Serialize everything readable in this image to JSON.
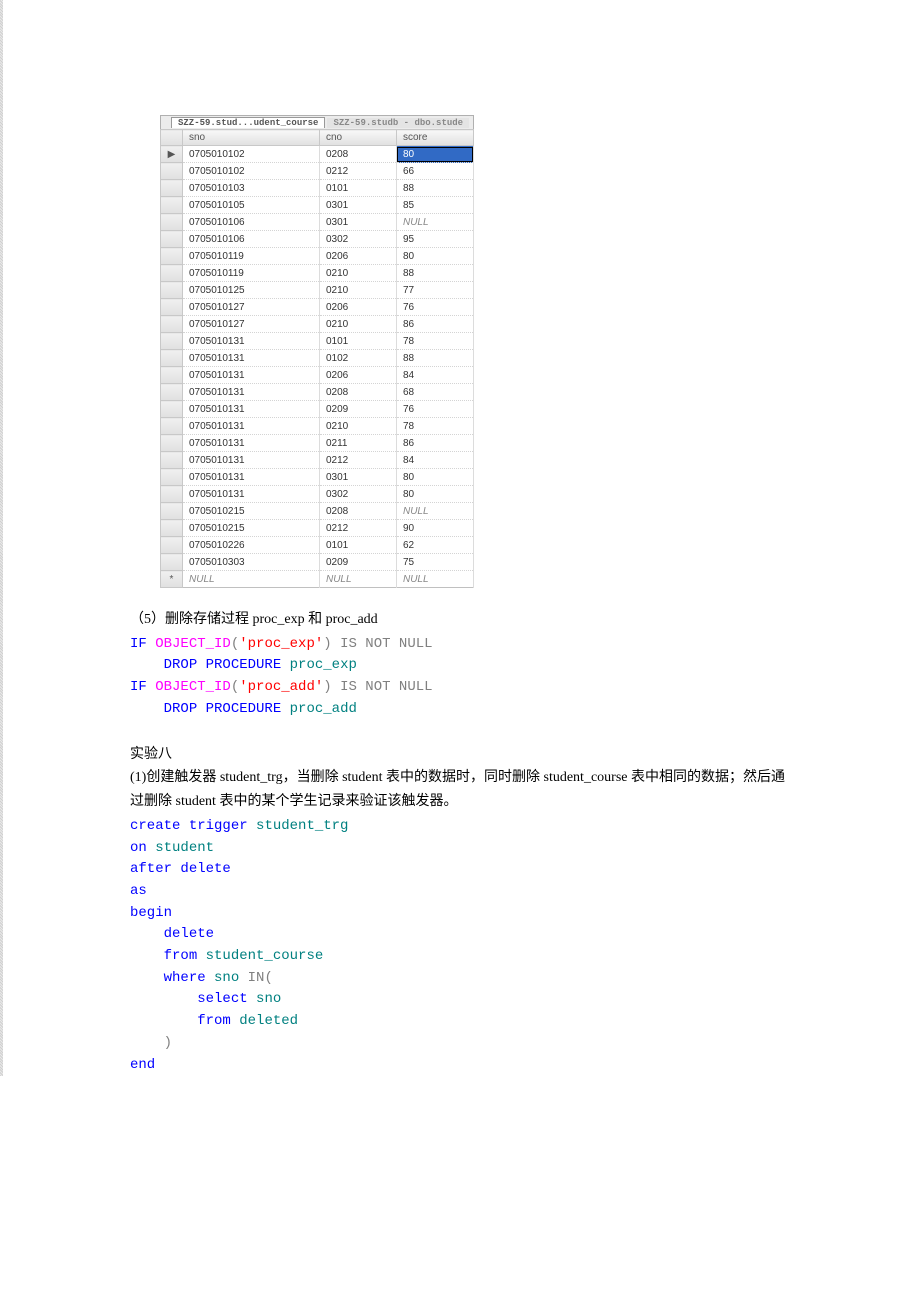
{
  "tabs": {
    "active": "SZZ-59.stud...udent_course",
    "inactive": "SZZ-59.studb - dbo.stude"
  },
  "grid": {
    "columns": [
      "sno",
      "cno",
      "score"
    ],
    "rows": [
      {
        "sno": "0705010102",
        "cno": "0208",
        "score": "80",
        "selected": true,
        "marker": "▶"
      },
      {
        "sno": "0705010102",
        "cno": "0212",
        "score": "66"
      },
      {
        "sno": "0705010103",
        "cno": "0101",
        "score": "88"
      },
      {
        "sno": "0705010105",
        "cno": "0301",
        "score": "85"
      },
      {
        "sno": "0705010106",
        "cno": "0301",
        "score": "NULL",
        "null_score": true
      },
      {
        "sno": "0705010106",
        "cno": "0302",
        "score": "95"
      },
      {
        "sno": "0705010119",
        "cno": "0206",
        "score": "80"
      },
      {
        "sno": "0705010119",
        "cno": "0210",
        "score": "88"
      },
      {
        "sno": "0705010125",
        "cno": "0210",
        "score": "77"
      },
      {
        "sno": "0705010127",
        "cno": "0206",
        "score": "76"
      },
      {
        "sno": "0705010127",
        "cno": "0210",
        "score": "86"
      },
      {
        "sno": "0705010131",
        "cno": "0101",
        "score": "78"
      },
      {
        "sno": "0705010131",
        "cno": "0102",
        "score": "88"
      },
      {
        "sno": "0705010131",
        "cno": "0206",
        "score": "84"
      },
      {
        "sno": "0705010131",
        "cno": "0208",
        "score": "68"
      },
      {
        "sno": "0705010131",
        "cno": "0209",
        "score": "76"
      },
      {
        "sno": "0705010131",
        "cno": "0210",
        "score": "78"
      },
      {
        "sno": "0705010131",
        "cno": "0211",
        "score": "86"
      },
      {
        "sno": "0705010131",
        "cno": "0212",
        "score": "84"
      },
      {
        "sno": "0705010131",
        "cno": "0301",
        "score": "80"
      },
      {
        "sno": "0705010131",
        "cno": "0302",
        "score": "80"
      },
      {
        "sno": "0705010215",
        "cno": "0208",
        "score": "NULL",
        "null_score": true
      },
      {
        "sno": "0705010215",
        "cno": "0212",
        "score": "90"
      },
      {
        "sno": "0705010226",
        "cno": "0101",
        "score": "62"
      },
      {
        "sno": "0705010303",
        "cno": "0209",
        "score": "75"
      }
    ],
    "new_row_marker": "*",
    "null_label": "NULL"
  },
  "section5": {
    "heading": "（5）删除存储过程 proc_exp 和 proc_add",
    "sql_lines": [
      [
        {
          "t": "IF",
          "c": "kw"
        },
        {
          "t": " "
        },
        {
          "t": "OBJECT_ID",
          "c": "func"
        },
        {
          "t": "(",
          "c": "op"
        },
        {
          "t": "'proc_exp'",
          "c": "str"
        },
        {
          "t": ")",
          "c": "op"
        },
        {
          "t": " "
        },
        {
          "t": "IS",
          "c": "op"
        },
        {
          "t": " "
        },
        {
          "t": "NOT",
          "c": "op"
        },
        {
          "t": " "
        },
        {
          "t": "NULL",
          "c": "op"
        }
      ],
      [
        {
          "t": "    "
        },
        {
          "t": "DROP",
          "c": "kw"
        },
        {
          "t": " "
        },
        {
          "t": "PROCEDURE",
          "c": "kw"
        },
        {
          "t": " "
        },
        {
          "t": "proc_exp",
          "c": "ident"
        }
      ],
      [
        {
          "t": "IF",
          "c": "kw"
        },
        {
          "t": " "
        },
        {
          "t": "OBJECT_ID",
          "c": "func"
        },
        {
          "t": "(",
          "c": "op"
        },
        {
          "t": "'proc_add'",
          "c": "str"
        },
        {
          "t": ")",
          "c": "op"
        },
        {
          "t": " "
        },
        {
          "t": "IS",
          "c": "op"
        },
        {
          "t": " "
        },
        {
          "t": "NOT",
          "c": "op"
        },
        {
          "t": " "
        },
        {
          "t": "NULL",
          "c": "op"
        }
      ],
      [
        {
          "t": "    "
        },
        {
          "t": "DROP",
          "c": "kw"
        },
        {
          "t": " "
        },
        {
          "t": "PROCEDURE",
          "c": "kw"
        },
        {
          "t": " "
        },
        {
          "t": "proc_add",
          "c": "ident"
        }
      ]
    ]
  },
  "exp8": {
    "title": "实验八",
    "desc": "(1)创建触发器 student_trg，当删除 student 表中的数据时，同时删除 student_course 表中相同的数据；然后通过删除 student 表中的某个学生记录来验证该触发器。",
    "sql_lines": [
      [
        {
          "t": "create",
          "c": "kw"
        },
        {
          "t": " "
        },
        {
          "t": "trigger",
          "c": "kw"
        },
        {
          "t": " "
        },
        {
          "t": "student_trg",
          "c": "ident"
        }
      ],
      [
        {
          "t": "on",
          "c": "kw"
        },
        {
          "t": " "
        },
        {
          "t": "student",
          "c": "ident"
        }
      ],
      [
        {
          "t": "after",
          "c": "kw"
        },
        {
          "t": " "
        },
        {
          "t": "delete",
          "c": "kw"
        }
      ],
      [
        {
          "t": "as",
          "c": "kw"
        }
      ],
      [
        {
          "t": "begin",
          "c": "kw"
        }
      ],
      [
        {
          "t": "    "
        },
        {
          "t": "delete",
          "c": "kw"
        }
      ],
      [
        {
          "t": "    "
        },
        {
          "t": "from",
          "c": "kw"
        },
        {
          "t": " "
        },
        {
          "t": "student_course",
          "c": "ident"
        }
      ],
      [
        {
          "t": "    "
        },
        {
          "t": "where",
          "c": "kw"
        },
        {
          "t": " "
        },
        {
          "t": "sno",
          "c": "ident"
        },
        {
          "t": " "
        },
        {
          "t": "IN",
          "c": "op"
        },
        {
          "t": "(",
          "c": "op"
        }
      ],
      [
        {
          "t": "        "
        },
        {
          "t": "select",
          "c": "kw"
        },
        {
          "t": " "
        },
        {
          "t": "sno",
          "c": "ident"
        }
      ],
      [
        {
          "t": "        "
        },
        {
          "t": "from",
          "c": "kw"
        },
        {
          "t": " "
        },
        {
          "t": "deleted",
          "c": "ident"
        }
      ],
      [
        {
          "t": "    "
        },
        {
          "t": ")",
          "c": "op"
        }
      ],
      [
        {
          "t": "end",
          "c": "kw"
        }
      ]
    ]
  }
}
